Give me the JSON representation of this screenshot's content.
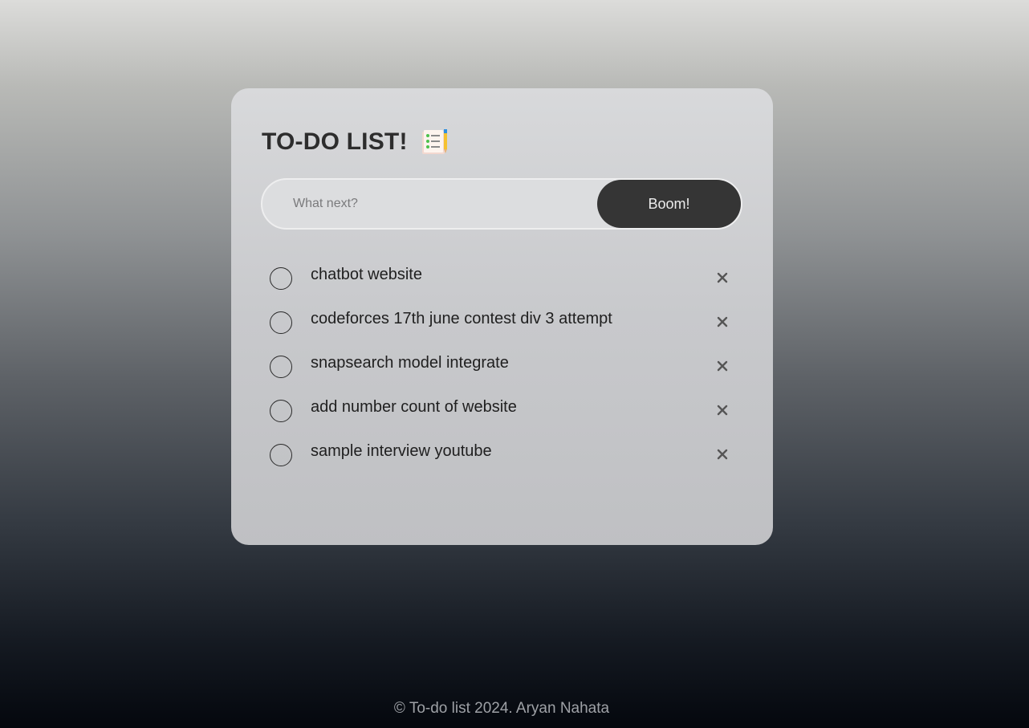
{
  "header": {
    "title": "TO-DO LIST!",
    "title_icon": "checklist-notepad-icon"
  },
  "input": {
    "placeholder": "What next?",
    "value": ""
  },
  "add_button": {
    "label": "Boom!"
  },
  "tasks": [
    {
      "text": "chatbot website",
      "done": false
    },
    {
      "text": "codeforces 17th june contest div 3 attempt",
      "done": false
    },
    {
      "text": "snapsearch model integrate",
      "done": false
    },
    {
      "text": "add number count of website",
      "done": false
    },
    {
      "text": "sample interview youtube",
      "done": false
    }
  ],
  "footer": {
    "text": "© To-do list 2024. Aryan Nahata"
  },
  "colors": {
    "button_bg": "#353535",
    "card_bg": "#cfd0d2",
    "text": "#2d2d2d"
  }
}
